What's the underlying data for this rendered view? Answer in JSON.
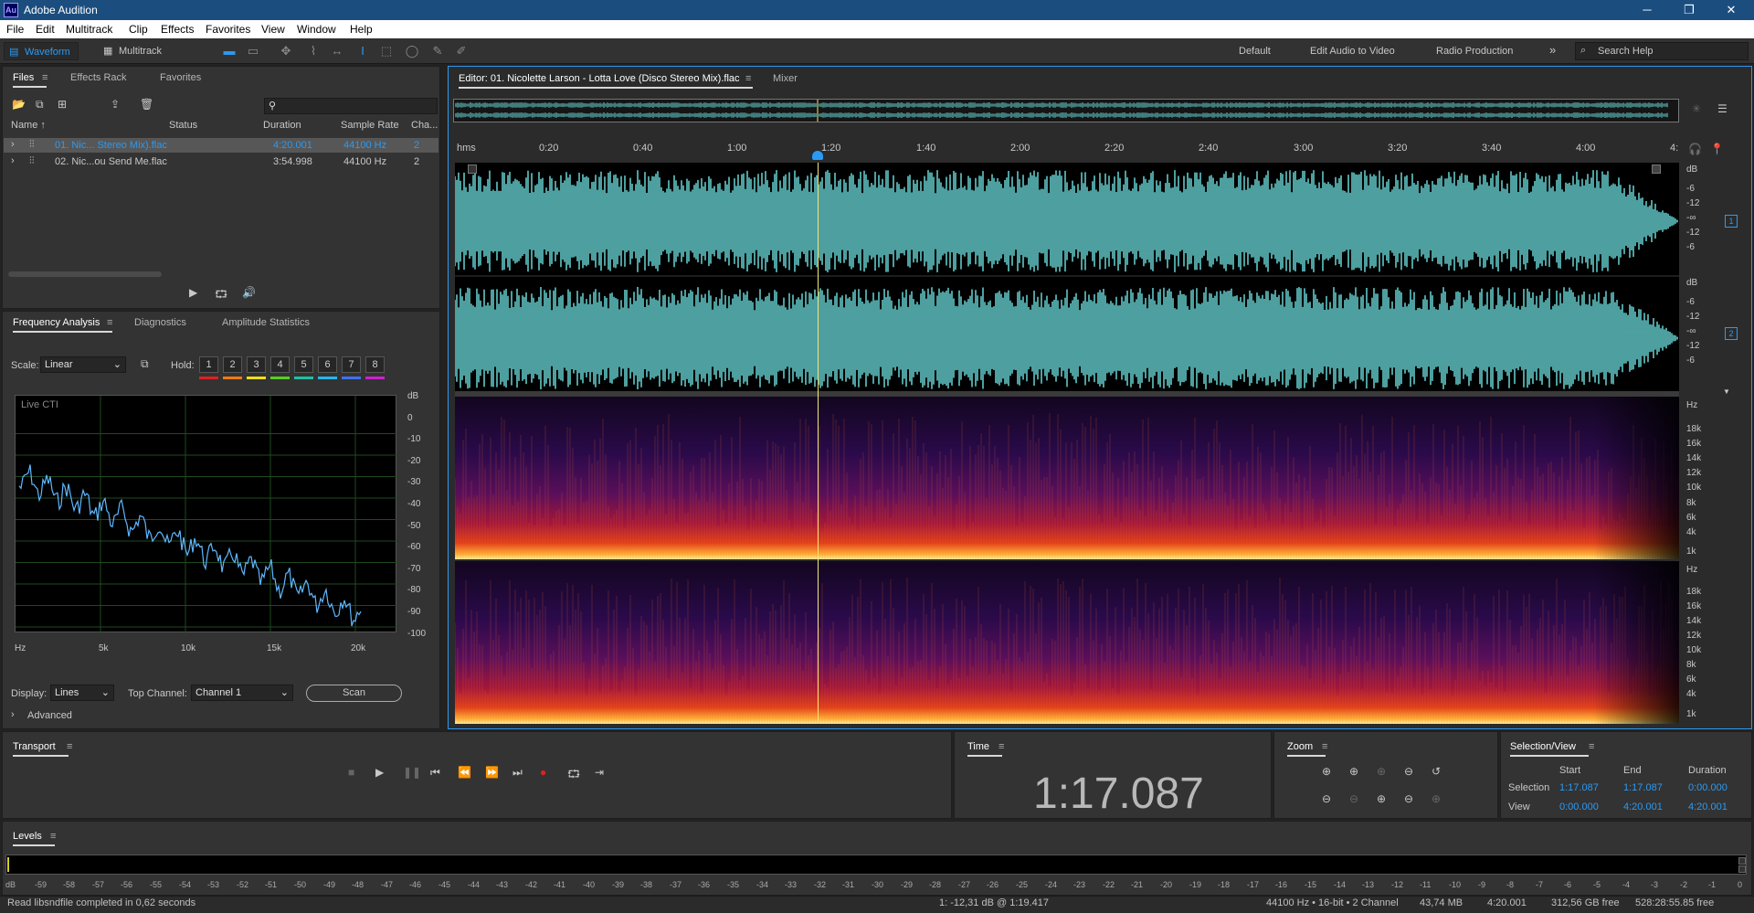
{
  "app": {
    "title": "Adobe Audition",
    "logo": "Au"
  },
  "menu": [
    "File",
    "Edit",
    "Multitrack",
    "Clip",
    "Effects",
    "Favorites",
    "View",
    "Window",
    "Help"
  ],
  "toolbar": {
    "waveform_label": "Waveform",
    "multitrack_label": "Multitrack",
    "workspaces": [
      "Default",
      "Edit Audio to Video",
      "Radio Production"
    ],
    "more": "»",
    "search_placeholder": "Search Help"
  },
  "files_panel": {
    "tabs": [
      "Files",
      "Effects Rack",
      "Favorites"
    ],
    "search_placeholder": "",
    "columns": [
      "Name ↑",
      "Status",
      "Duration",
      "Sample Rate",
      "Cha..."
    ],
    "rows": [
      {
        "name": "01. Nic... Stereo Mix).flac",
        "status": "",
        "duration": "4:20.001",
        "sample_rate": "44100 Hz",
        "channels": "2",
        "selected": true
      },
      {
        "name": "02. Nic...ou Send Me.flac",
        "status": "",
        "duration": "3:54.998",
        "sample_rate": "44100 Hz",
        "channels": "2",
        "selected": false
      }
    ]
  },
  "analysis_panel": {
    "tabs": [
      "Frequency Analysis",
      "Diagnostics",
      "Amplitude Statistics"
    ],
    "scale_label": "Scale:",
    "scale_value": "Linear",
    "hold_label": "Hold:",
    "hold_buttons": [
      "1",
      "2",
      "3",
      "4",
      "5",
      "6",
      "7",
      "8"
    ],
    "hold_colors": [
      "#e02020",
      "#f07a10",
      "#f0e010",
      "#58d020",
      "#20c0a0",
      "#20b8f0",
      "#4070f0",
      "#d020d0"
    ],
    "plot_label": "Live CTI",
    "db_ticks": [
      "dB",
      "0",
      "-10",
      "-20",
      "-30",
      "-40",
      "-50",
      "-60",
      "-70",
      "-80",
      "-90",
      "-100"
    ],
    "freq_ticks": [
      "Hz",
      "5k",
      "10k",
      "15k",
      "20k"
    ],
    "display_label": "Display:",
    "display_value": "Lines",
    "top_channel_label": "Top Channel:",
    "top_channel_value": "Channel 1",
    "scan_label": "Scan",
    "advanced_label": "Advanced"
  },
  "editor": {
    "tab_label": "Editor: 01. Nicolette Larson - Lotta Love (Disco Stereo Mix).flac",
    "mixer_label": "Mixer",
    "ruler": [
      "hms",
      "0:20",
      "0:40",
      "1:00",
      "1:20",
      "1:40",
      "2:00",
      "2:20",
      "2:40",
      "3:00",
      "3:20",
      "3:40",
      "4:00",
      "4:"
    ],
    "wave_db": [
      "dB",
      "-6",
      "-12",
      "-∞",
      "-12",
      "-6"
    ],
    "channel_badges": [
      "1",
      "2"
    ],
    "spec_ticks": [
      "Hz",
      "18k",
      "16k",
      "14k",
      "12k",
      "10k",
      "8k",
      "6k",
      "4k",
      "1k"
    ],
    "waveform_color": "#6fe3e3",
    "playhead_color": "#f5e87a"
  },
  "transport": {
    "title": "Transport",
    "buttons": [
      "stop-icon",
      "play-icon",
      "pause-icon",
      "go-to-start-icon",
      "rewind-icon",
      "fast-forward-icon",
      "go-to-end-icon",
      "record-icon",
      "loop-icon",
      "skip-icon"
    ]
  },
  "time_panel": {
    "title": "Time",
    "value": "1:17.087"
  },
  "zoom_panel": {
    "title": "Zoom"
  },
  "selection_panel": {
    "title": "Selection/View",
    "headers": [
      "Start",
      "End",
      "Duration"
    ],
    "rows": [
      {
        "label": "Selection",
        "start": "1:17.087",
        "end": "1:17.087",
        "duration": "0:00.000"
      },
      {
        "label": "View",
        "start": "0:00.000",
        "end": "4:20.001",
        "duration": "4:20.001"
      }
    ]
  },
  "levels_panel": {
    "title": "Levels",
    "ticks": [
      "dB",
      "-59",
      "-58",
      "-57",
      "-56",
      "-55",
      "-54",
      "-53",
      "-52",
      "-51",
      "-50",
      "-49",
      "-48",
      "-47",
      "-46",
      "-45",
      "-44",
      "-43",
      "-42",
      "-41",
      "-40",
      "-39",
      "-38",
      "-37",
      "-36",
      "-35",
      "-34",
      "-33",
      "-32",
      "-31",
      "-30",
      "-29",
      "-28",
      "-27",
      "-26",
      "-25",
      "-24",
      "-23",
      "-22",
      "-21",
      "-20",
      "-19",
      "-18",
      "-17",
      "-16",
      "-15",
      "-14",
      "-13",
      "-12",
      "-11",
      "-10",
      "-9",
      "-8",
      "-7",
      "-6",
      "-5",
      "-4",
      "-3",
      "-2",
      "-1",
      "0"
    ]
  },
  "status": {
    "message": "Read libsndfile completed in 0,62 seconds",
    "cursor": "1: -12,31 dB @ 1:19.417",
    "format": "44100 Hz • 16-bit • 2 Channel",
    "size": "43,74 MB",
    "duration": "4:20.001",
    "free": "312,56 GB free",
    "free_time": "528:28:55.85 free"
  }
}
